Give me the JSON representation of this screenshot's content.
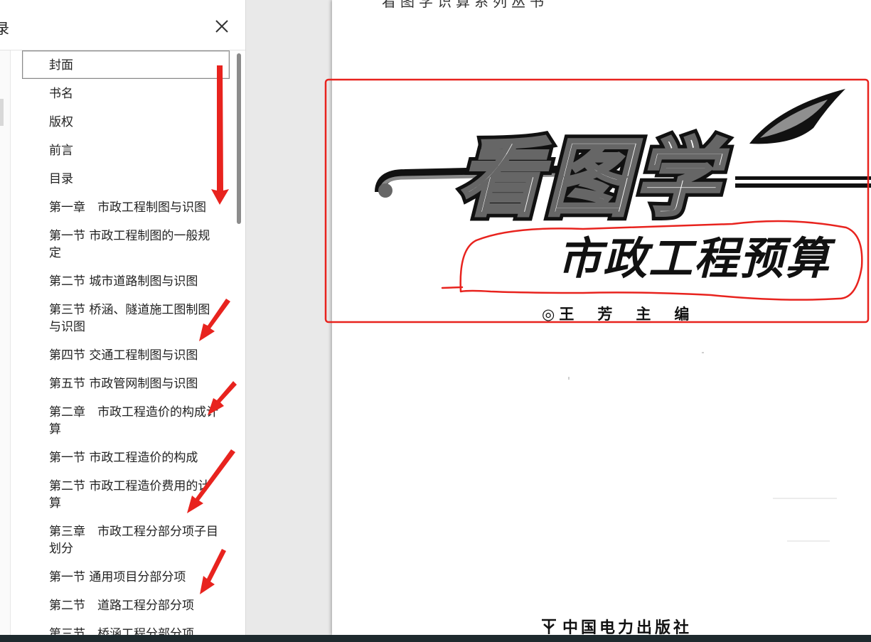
{
  "sidebar": {
    "header_glyph": "录",
    "toc": [
      {
        "label": "封面",
        "selected": true
      },
      {
        "label": "书名"
      },
      {
        "label": "版权"
      },
      {
        "label": "前言"
      },
      {
        "label": "目录"
      },
      {
        "label": "第一章　市政工程制图与识图"
      },
      {
        "label": "第一节 市政工程制图的一般规定"
      },
      {
        "label": "第二节 城市道路制图与识图"
      },
      {
        "label": "第三节 桥涵、隧道施工图制图与识图"
      },
      {
        "label": "第四节 交通工程制图与识图"
      },
      {
        "label": "第五节 市政管网制图与识图"
      },
      {
        "label": "第二章　市政工程造价的构成计算"
      },
      {
        "label": "第一节 市政工程造价的构成"
      },
      {
        "label": "第二节 市政工程造价费用的计算"
      },
      {
        "label": "第三章　市政工程分部分项子目划分"
      },
      {
        "label": "第一节 通用项目分部分项"
      },
      {
        "label": "第二节　道路工程分部分项"
      },
      {
        "label": "第三节　桥涵工程分部分项"
      }
    ]
  },
  "document": {
    "top_line": "看图学识算系列丛书",
    "title_main": "看图学",
    "title_sub": "市政工程预算",
    "author": "◎王　芳　主　编",
    "publisher": "中国电力出版社"
  },
  "colors": {
    "annotation_red": "#e8231e",
    "title_black": "#111111",
    "title_grey": "#777777",
    "viewer_bg": "#e9e9e9"
  },
  "icons": {
    "close": "close-icon",
    "publisher_logo": "publisher-logo-icon"
  }
}
